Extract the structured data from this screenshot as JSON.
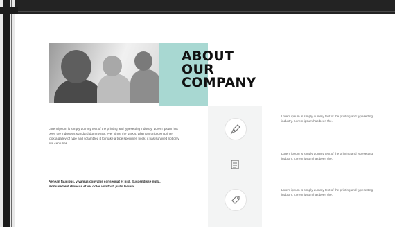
{
  "heading": {
    "line1": "ABOUT",
    "line2": "OUR",
    "line3": "COMPANY"
  },
  "left_column": {
    "paragraph1": "Lorem ipsum is simply dummy text of the printing and typesetting industry. Lorem ipsum has been the industry's standard dummy text ever since the 1500s, when an unknown printer took a galley of type and scrambled it to make a type specimen book, it has survived not only five centuries.",
    "paragraph2": "Aenean faucibus, vivamus convallis consequat et nisl. Suspendisse nulla. Morbi sed elit rhoncus et vel dolor volutpat, justo lacinia."
  },
  "icons": [
    "brush-icon",
    "document-icon",
    "tag-icon"
  ],
  "right_column": {
    "items": [
      "Lorem ipsum is simply dummy text of the printing and typesetting industry. Lorem ipsum has been the.",
      "Lorem ipsum is simply dummy text of the printing and typesetting industry. Lorem ipsum has been the.",
      "Lorem ipsum is simply dummy text of the printing and typesetting industry. Lorem ipsum has been the."
    ]
  },
  "colors": {
    "accent": "#a8d8d2",
    "frame": "#1c1c1c",
    "panel": "#f3f4f4"
  }
}
